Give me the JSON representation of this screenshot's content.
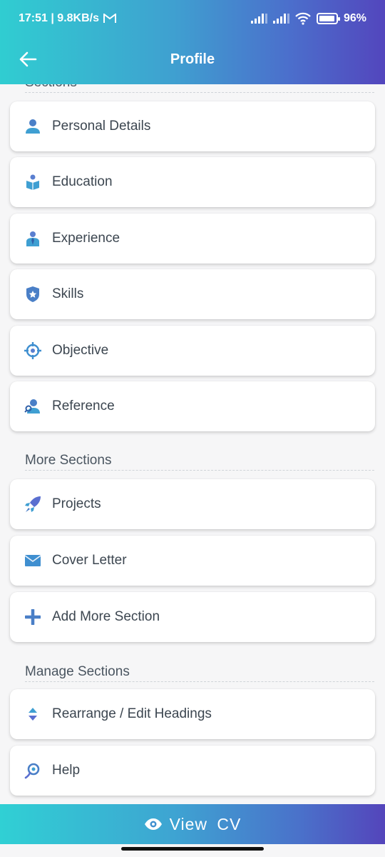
{
  "status_bar": {
    "time_speed": "17:51 | 9.8KB/s",
    "battery": "96%",
    "battery_level": 0.96
  },
  "appbar": {
    "title": "Profile"
  },
  "sections_heading": "Sections",
  "sections": [
    {
      "label": "Personal Details",
      "icon": "person-icon"
    },
    {
      "label": "Education",
      "icon": "book-reader-icon"
    },
    {
      "label": "Experience",
      "icon": "businessman-icon"
    },
    {
      "label": "Skills",
      "icon": "shield-star-icon"
    },
    {
      "label": "Objective",
      "icon": "crosshair-icon"
    },
    {
      "label": "Reference",
      "icon": "user-search-icon"
    }
  ],
  "more_sections_heading": "More Sections",
  "more_sections": [
    {
      "label": "Projects",
      "icon": "rocket-icon"
    },
    {
      "label": "Cover Letter",
      "icon": "envelope-icon"
    },
    {
      "label": "Add More Section",
      "icon": "plus-icon"
    }
  ],
  "manage_sections_heading": "Manage Sections",
  "manage_sections": [
    {
      "label": "Rearrange / Edit Headings",
      "icon": "sort-arrows-icon"
    },
    {
      "label": "Help",
      "icon": "help-icon"
    }
  ],
  "view_cv": {
    "label": "View CV",
    "icon": "eye-icon"
  },
  "colors": {
    "accent_start": "#30cdd1",
    "accent_end": "#5346bd",
    "icon_blue": "#4a86c8"
  }
}
